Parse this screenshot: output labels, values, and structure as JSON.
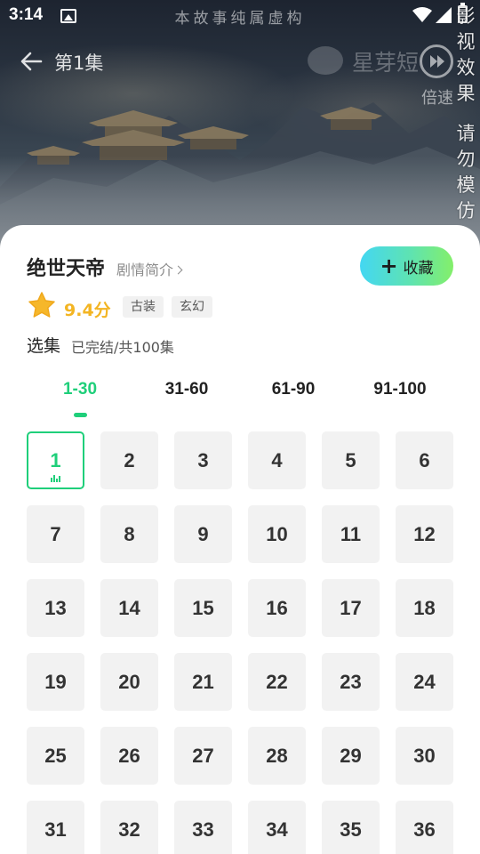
{
  "status_bar": {
    "time": "3:14"
  },
  "player": {
    "disclaimer": "本故事纯属虚构",
    "episode_title": "第1集",
    "watermark": "星芽短",
    "speed_label": "倍速",
    "side_notice": [
      "影",
      "视",
      "效",
      "果",
      "请",
      "勿",
      "模",
      "仿"
    ]
  },
  "drama": {
    "title": "绝世天帝",
    "synopsis_link": "剧情简介",
    "favorite_label": "收藏",
    "score": "9.4分",
    "tags": [
      "古装",
      "玄幻"
    ]
  },
  "episodes": {
    "label": "选集",
    "status": "已完结/共100集",
    "ranges": [
      "1-30",
      "31-60",
      "61-90",
      "91-100"
    ],
    "active_range": 0,
    "current_episode": 1,
    "items": [
      "1",
      "2",
      "3",
      "4",
      "5",
      "6",
      "7",
      "8",
      "9",
      "10",
      "11",
      "12",
      "13",
      "14",
      "15",
      "16",
      "17",
      "18",
      "19",
      "20",
      "21",
      "22",
      "23",
      "24",
      "25",
      "26",
      "27",
      "28",
      "29",
      "30",
      "31",
      "32",
      "33",
      "34",
      "35",
      "36"
    ]
  },
  "colors": {
    "accent": "#1fcf7a",
    "score": "#f3b523",
    "favorite_gradient": [
      "#43d7f2",
      "#84ef6a"
    ]
  },
  "icons": [
    "back-arrow-icon",
    "image-icon",
    "wifi-icon",
    "signal-icon",
    "battery-icon",
    "speed-icon",
    "star-icon",
    "plus-icon",
    "chevron-right-icon",
    "playing-bars-icon"
  ]
}
